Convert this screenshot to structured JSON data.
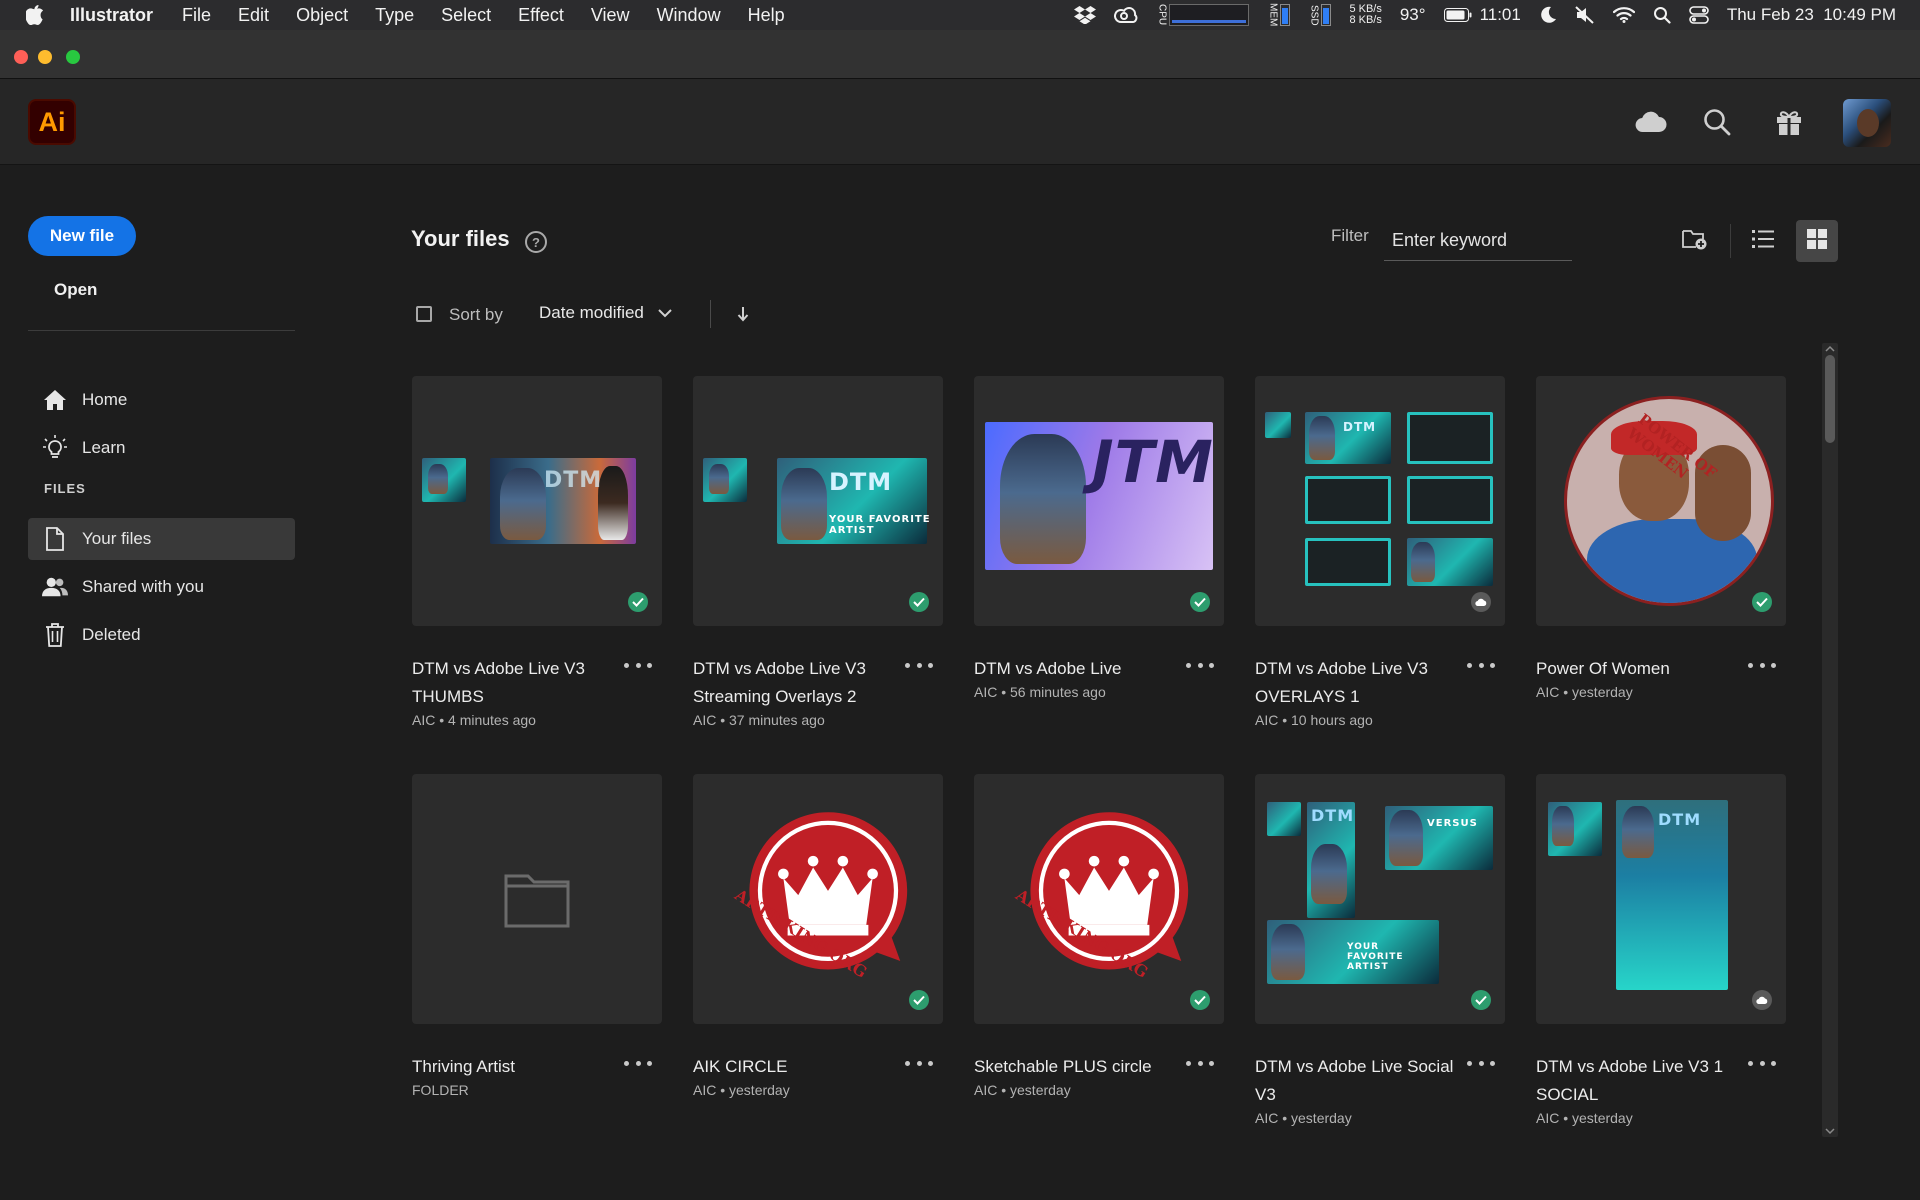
{
  "menubar": {
    "app_name": "Illustrator",
    "items": [
      "File",
      "Edit",
      "Object",
      "Type",
      "Select",
      "Effect",
      "View",
      "Window",
      "Help"
    ],
    "cpu_label": "CPU",
    "mem_label": "MEM",
    "ssd_label": "SSD",
    "net_up": "5 KB/s",
    "net_down": "8 KB/s",
    "temperature": "93°",
    "battery_time": "11:01",
    "datetime": "Thu Feb 23  10:49 PM"
  },
  "app": {
    "logo_text": "Ai"
  },
  "sidebar": {
    "new_file": "New file",
    "open": "Open",
    "nav": [
      {
        "label": "Home",
        "icon": "home-icon"
      },
      {
        "label": "Learn",
        "icon": "lightbulb-icon"
      }
    ],
    "files_heading": "FILES",
    "files_nav": [
      {
        "label": "Your files",
        "icon": "document-icon",
        "active": true
      },
      {
        "label": "Shared with you",
        "icon": "users-icon"
      },
      {
        "label": "Deleted",
        "icon": "trash-icon"
      }
    ]
  },
  "main": {
    "title": "Your files",
    "filter_label": "Filter",
    "filter_placeholder": "Enter keyword",
    "sort_by_label": "Sort by",
    "sort_value": "Date modified",
    "view_mode": "grid"
  },
  "files": [
    {
      "title": "DTM vs Adobe Live V3 THUMBS",
      "meta": "AIC • 4 minutes ago",
      "status": "synced"
    },
    {
      "title": "DTM vs Adobe Live V3 Streaming Overlays 2",
      "meta": "AIC • 37 minutes ago",
      "status": "synced"
    },
    {
      "title": "DTM vs Adobe Live",
      "meta": "AIC • 56 minutes ago",
      "status": "synced"
    },
    {
      "title": "DTM vs Adobe Live V3 OVERLAYS 1",
      "meta": "AIC • 10 hours ago",
      "status": "cloud"
    },
    {
      "title": "Power Of Women",
      "meta": "AIC • yesterday",
      "status": "synced"
    },
    {
      "title": "Thriving Artist",
      "meta": "FOLDER",
      "status": "none"
    },
    {
      "title": "AIK CIRCLE",
      "meta": "AIC • yesterday",
      "status": "synced"
    },
    {
      "title": "Sketchable PLUS circle",
      "meta": "AIC • yesterday",
      "status": "synced"
    },
    {
      "title": "DTM vs Adobe Live Social V3",
      "meta": "AIC • yesterday",
      "status": "synced"
    },
    {
      "title": "DTM vs Adobe Live V3 1 SOCIAL",
      "meta": "AIC • yesterday",
      "status": "cloud"
    }
  ],
  "artwork_text": {
    "dtm": "DTM",
    "versus": "VERSUS",
    "favorite_artist": "YOUR FAVORITE ARTIST",
    "jtm": "JTM",
    "power_of_women": "POWER OF WOMEN",
    "artisking": "ARTISKING.ORG"
  },
  "colors": {
    "accent": "#1473e6",
    "synced": "#2d9d6e",
    "background": "#1d1d1d",
    "logo_bg": "#330000",
    "logo_fg": "#ff9a00"
  }
}
